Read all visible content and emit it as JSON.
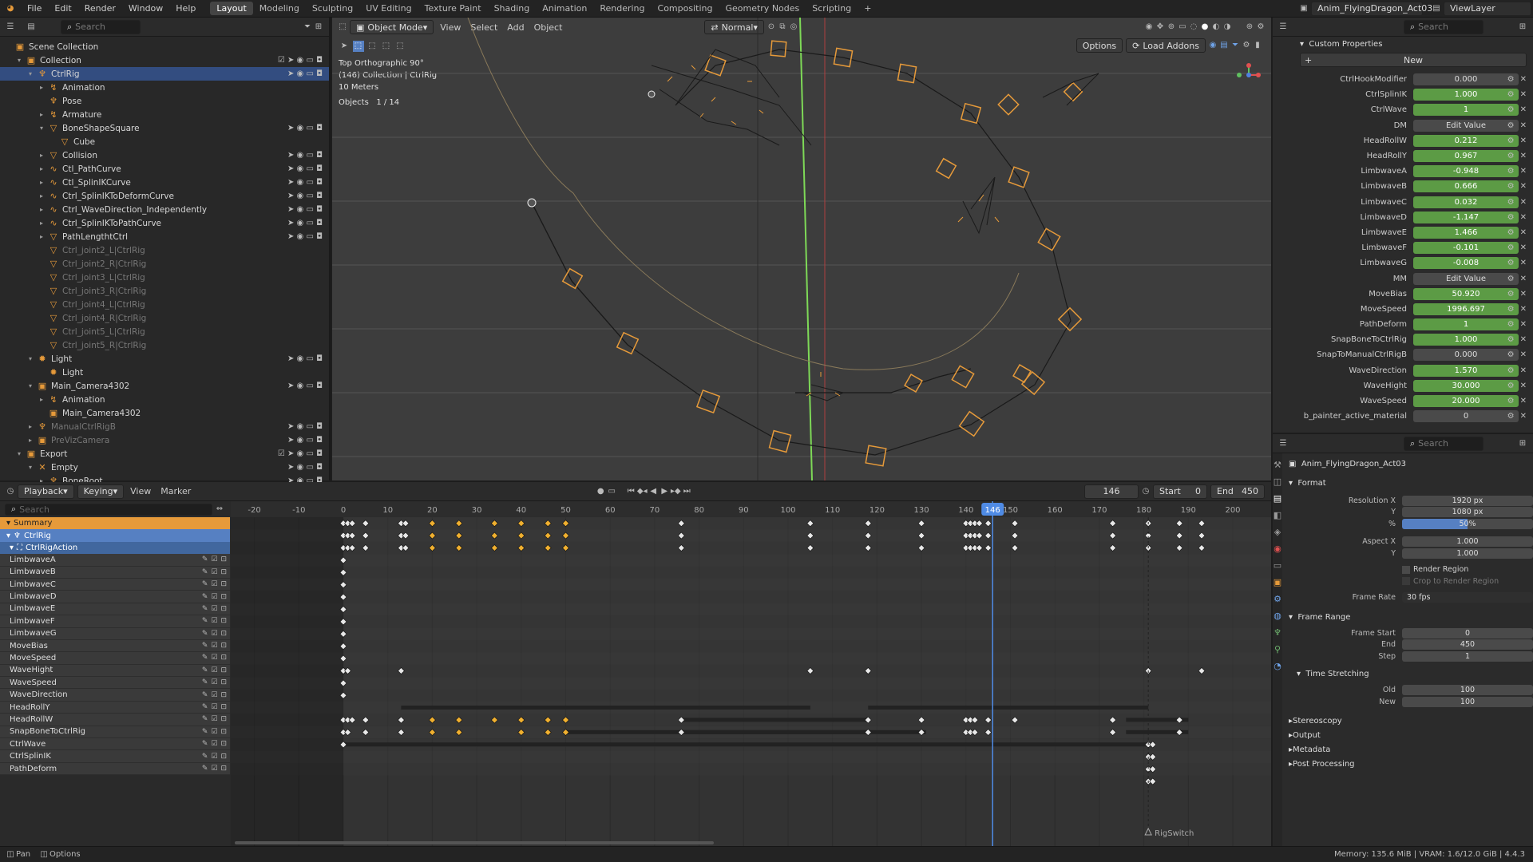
{
  "topbar": {
    "menus": [
      "File",
      "Edit",
      "Render",
      "Window",
      "Help"
    ],
    "workspaces": [
      "Layout",
      "Modeling",
      "Sculpting",
      "UV Editing",
      "Texture Paint",
      "Shading",
      "Animation",
      "Rendering",
      "Compositing",
      "Geometry Nodes",
      "Scripting"
    ],
    "active_workspace": "Layout",
    "scene": "Anim_FlyingDragon_Act03",
    "view_layer": "ViewLayer"
  },
  "outliner": {
    "search_placeholder": "Search",
    "rows": [
      {
        "label": "Scene Collection",
        "indent": 0,
        "tri": "",
        "icon": "▣",
        "sel": false,
        "dim": false
      },
      {
        "label": "Collection",
        "indent": 1,
        "tri": "▾",
        "icon": "▣",
        "sel": false,
        "dim": false,
        "right": "☑ ➤ ◉ ▭ ◘"
      },
      {
        "label": "CtrlRig",
        "indent": 2,
        "tri": "▾",
        "icon": "♆",
        "sel": true,
        "dim": false,
        "right": "➤ ◉ ▭ ◘"
      },
      {
        "label": "Animation",
        "indent": 3,
        "tri": "▸",
        "icon": "↯",
        "sel": false,
        "dim": false
      },
      {
        "label": "Pose",
        "indent": 3,
        "tri": "",
        "icon": "♆",
        "sel": false,
        "dim": false
      },
      {
        "label": "Armature",
        "indent": 3,
        "tri": "▸",
        "icon": "↯",
        "sel": false,
        "dim": false
      },
      {
        "label": "BoneShapeSquare",
        "indent": 3,
        "tri": "▾",
        "icon": "▽",
        "sel": false,
        "dim": false,
        "right": "➤ ◉ ▭ ◘"
      },
      {
        "label": "Cube",
        "indent": 4,
        "tri": "",
        "icon": "▽",
        "sel": false,
        "dim": false
      },
      {
        "label": "Collision",
        "indent": 3,
        "tri": "▸",
        "icon": "▽",
        "sel": false,
        "dim": false,
        "right": "➤ ◉ ▭ ◘"
      },
      {
        "label": "Ctl_PathCurve",
        "indent": 3,
        "tri": "▸",
        "icon": "∿",
        "sel": false,
        "dim": false,
        "right": "➤ ◉ ▭ ◘"
      },
      {
        "label": "Ctl_SplinIKCurve",
        "indent": 3,
        "tri": "▸",
        "icon": "∿",
        "sel": false,
        "dim": false,
        "right": "➤ ◉ ▭ ◘"
      },
      {
        "label": "Ctrl_SplinIKToDeformCurve",
        "indent": 3,
        "tri": "▸",
        "icon": "∿",
        "sel": false,
        "dim": false,
        "right": "➤ ◉ ▭ ◘"
      },
      {
        "label": "Ctrl_WaveDirection_Independently",
        "indent": 3,
        "tri": "▸",
        "icon": "∿",
        "sel": false,
        "dim": false,
        "right": "➤ ◉ ▭ ◘"
      },
      {
        "label": "Ctrl_SplinIKToPathCurve",
        "indent": 3,
        "tri": "▸",
        "icon": "∿",
        "sel": false,
        "dim": false,
        "right": "➤ ◉ ▭ ◘"
      },
      {
        "label": "PathLengthtCtrl",
        "indent": 3,
        "tri": "▸",
        "icon": "▽",
        "sel": false,
        "dim": false,
        "right": "➤ ◉ ▭ ◘"
      },
      {
        "label": "Ctrl_joint2_L|CtrlRig",
        "indent": 3,
        "tri": "",
        "icon": "▽",
        "sel": false,
        "dim": true
      },
      {
        "label": "Ctrl_joint2_R|CtrlRig",
        "indent": 3,
        "tri": "",
        "icon": "▽",
        "sel": false,
        "dim": true
      },
      {
        "label": "Ctrl_joint3_L|CtrlRig",
        "indent": 3,
        "tri": "",
        "icon": "▽",
        "sel": false,
        "dim": true
      },
      {
        "label": "Ctrl_joint3_R|CtrlRig",
        "indent": 3,
        "tri": "",
        "icon": "▽",
        "sel": false,
        "dim": true
      },
      {
        "label": "Ctrl_joint4_L|CtrlRig",
        "indent": 3,
        "tri": "",
        "icon": "▽",
        "sel": false,
        "dim": true
      },
      {
        "label": "Ctrl_joint4_R|CtrlRig",
        "indent": 3,
        "tri": "",
        "icon": "▽",
        "sel": false,
        "dim": true
      },
      {
        "label": "Ctrl_joint5_L|CtrlRig",
        "indent": 3,
        "tri": "",
        "icon": "▽",
        "sel": false,
        "dim": true
      },
      {
        "label": "Ctrl_joint5_R|CtrlRig",
        "indent": 3,
        "tri": "",
        "icon": "▽",
        "sel": false,
        "dim": true
      },
      {
        "label": "Light",
        "indent": 2,
        "tri": "▾",
        "icon": "✹",
        "sel": false,
        "dim": false,
        "right": "➤ ◉ ▭ ◘"
      },
      {
        "label": "Light",
        "indent": 3,
        "tri": "",
        "icon": "✹",
        "sel": false,
        "dim": false
      },
      {
        "label": "Main_Camera4302",
        "indent": 2,
        "tri": "▾",
        "icon": "▣",
        "sel": false,
        "dim": false,
        "right": "➤ ◉ ▭ ◘"
      },
      {
        "label": "Animation",
        "indent": 3,
        "tri": "▸",
        "icon": "↯",
        "sel": false,
        "dim": false
      },
      {
        "label": "Main_Camera4302",
        "indent": 3,
        "tri": "",
        "icon": "▣",
        "sel": false,
        "dim": false
      },
      {
        "label": "ManualCtrlRigB",
        "indent": 2,
        "tri": "▸",
        "icon": "♆",
        "sel": false,
        "dim": true,
        "right": "➤ ◉ ▭ ◘"
      },
      {
        "label": "PreVizCamera",
        "indent": 2,
        "tri": "▸",
        "icon": "▣",
        "sel": false,
        "dim": true,
        "right": "➤ ◉ ▭ ◘"
      },
      {
        "label": "Export",
        "indent": 1,
        "tri": "▾",
        "icon": "▣",
        "sel": false,
        "dim": false,
        "right": "☑ ➤ ◉ ▭ ◘"
      },
      {
        "label": "Empty",
        "indent": 2,
        "tri": "▾",
        "icon": "✕",
        "sel": false,
        "dim": false,
        "right": "➤ ◉ ▭ ◘"
      },
      {
        "label": "BoneRoot",
        "indent": 3,
        "tri": "▸",
        "icon": "♆",
        "sel": false,
        "dim": false,
        "right": "➤ ◉ ▭ ◘"
      }
    ]
  },
  "viewport": {
    "mode": "Object Mode",
    "menus": [
      "View",
      "Select",
      "Add",
      "Object"
    ],
    "transform": "Normal",
    "options": "Options",
    "load_addons": "Load Addons",
    "overlay_line1": "Top Orthographic 90°",
    "overlay_line2": "(146) Collection | CtrlRig",
    "overlay_line3": "10 Meters",
    "objects_label": "Objects",
    "objects_count": "1 / 14"
  },
  "dopesheet": {
    "menus": [
      "Playback",
      "Keying",
      "View",
      "Marker"
    ],
    "current_frame": "146",
    "start_label": "Start",
    "start": "0",
    "end_label": "End",
    "end": "450",
    "search_placeholder": "Search",
    "ticks": [
      "-20",
      "-10",
      "0",
      "10",
      "20",
      "30",
      "40",
      "50",
      "60",
      "70",
      "80",
      "90",
      "100",
      "110",
      "120",
      "130",
      "140",
      "150",
      "160",
      "170",
      "180",
      "190",
      "200"
    ],
    "summary": "Summary",
    "object": "CtrlRig",
    "action": "CtrlRigAction",
    "channels": [
      "LimbwaveA",
      "LimbwaveB",
      "LimbwaveC",
      "LimbwaveD",
      "LimbwaveE",
      "LimbwaveF",
      "LimbwaveG",
      "MoveBias",
      "MoveSpeed",
      "WaveHight",
      "WaveSpeed",
      "WaveDirection",
      "HeadRollY",
      "HeadRollW",
      "SnapBoneToCtrlRig",
      "CtrlWave",
      "CtrlSplinIK",
      "PathDeform"
    ],
    "marker": "RigSwitch"
  },
  "properties": {
    "search_placeholder": "Search",
    "section": "Custom Properties",
    "new_button": "New",
    "rows": [
      {
        "label": "CtrlHookModifier",
        "value": "0.000",
        "type": "d"
      },
      {
        "label": "CtrlSplinIK",
        "value": "1.000",
        "type": "g"
      },
      {
        "label": "CtrlWave",
        "value": "1",
        "type": "g"
      },
      {
        "label": "DM",
        "value": "Edit Value",
        "type": "d"
      },
      {
        "label": "HeadRollW",
        "value": "0.212",
        "type": "g"
      },
      {
        "label": "HeadRollY",
        "value": "0.967",
        "type": "g"
      },
      {
        "label": "LimbwaveA",
        "value": "-0.948",
        "type": "g"
      },
      {
        "label": "LimbwaveB",
        "value": "0.666",
        "type": "g"
      },
      {
        "label": "LimbwaveC",
        "value": "0.032",
        "type": "g"
      },
      {
        "label": "LimbwaveD",
        "value": "-1.147",
        "type": "g"
      },
      {
        "label": "LimbwaveE",
        "value": "1.466",
        "type": "g"
      },
      {
        "label": "LimbwaveF",
        "value": "-0.101",
        "type": "g"
      },
      {
        "label": "LimbwaveG",
        "value": "-0.008",
        "type": "g"
      },
      {
        "label": "MM",
        "value": "Edit Value",
        "type": "d"
      },
      {
        "label": "MoveBias",
        "value": "50.920",
        "type": "g"
      },
      {
        "label": "MoveSpeed",
        "value": "1996.697",
        "type": "g"
      },
      {
        "label": "PathDeform",
        "value": "1",
        "type": "g"
      },
      {
        "label": "SnapBoneToCtrlRig",
        "value": "1.000",
        "type": "g"
      },
      {
        "label": "SnapToManualCtrlRigB",
        "value": "0.000",
        "type": "d"
      },
      {
        "label": "WaveDirection",
        "value": "1.570",
        "type": "g"
      },
      {
        "label": "WaveHight",
        "value": "30.000",
        "type": "g"
      },
      {
        "label": "WaveSpeed",
        "value": "20.000",
        "type": "g"
      },
      {
        "label": "b_painter_active_material",
        "value": "0",
        "type": "d"
      }
    ]
  },
  "output_props": {
    "search_placeholder": "Search",
    "scene_name": "Anim_FlyingDragon_Act03",
    "format_label": "Format",
    "res_x_label": "Resolution X",
    "res_x": "1920 px",
    "res_y_label": "Y",
    "res_y": "1080 px",
    "pct_label": "%",
    "pct": "50%",
    "aspect_x_label": "Aspect X",
    "aspect_x": "1.000",
    "aspect_y_label": "Y",
    "aspect_y": "1.000",
    "render_region": "Render Region",
    "crop_region": "Crop to Render Region",
    "frame_rate_label": "Frame Rate",
    "frame_rate": "30 fps",
    "frame_range_label": "Frame Range",
    "frame_start_label": "Frame Start",
    "frame_start": "0",
    "end_label": "End",
    "end": "450",
    "step_label": "Step",
    "step": "1",
    "time_stretching_label": "Time Stretching",
    "old_label": "Old",
    "old": "100",
    "new_label": "New",
    "new": "100",
    "collapsed": [
      "Stereoscopy",
      "Output",
      "Metadata",
      "Post Processing"
    ]
  },
  "statusbar": {
    "pan": "Pan",
    "options": "Options",
    "memory": "Memory: 135.6 MiB | VRAM: 1.6/12.0 GiB | 4.4.3"
  },
  "colors": {
    "accent": "#e69a3a",
    "selection": "#334d80",
    "green_field": "#5c9b45",
    "playhead": "#4f8be5"
  }
}
